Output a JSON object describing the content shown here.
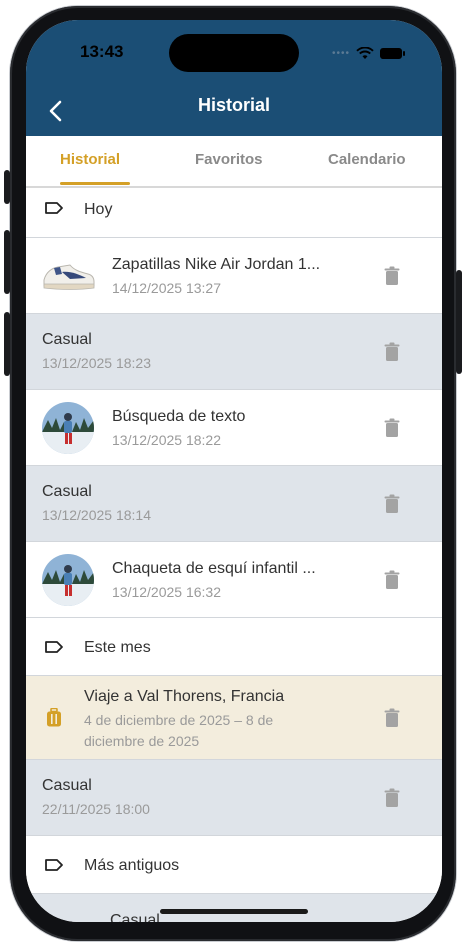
{
  "status_bar": {
    "time": "13:43"
  },
  "header": {
    "title": "Historial"
  },
  "tabs": [
    {
      "label": "Historial",
      "active": true
    },
    {
      "label": "Favoritos",
      "active": false
    },
    {
      "label": "Calendario",
      "active": false
    }
  ],
  "sections": {
    "today": "Hoy",
    "this_month": "Este mes",
    "older": "Más antiguos"
  },
  "items": [
    {
      "type": "product",
      "icon": "sneaker-thumbnail",
      "title": "Zapatillas Nike Air Jordan 1...",
      "date": "14/12/2025 13:27"
    },
    {
      "type": "outfit",
      "title": "Casual",
      "date": "13/12/2025 18:23"
    },
    {
      "type": "search",
      "icon": "ski-photo-thumbnail",
      "title": "Búsqueda de texto",
      "date": "13/12/2025 18:22"
    },
    {
      "type": "outfit",
      "title": "Casual",
      "date": "13/12/2025 18:14"
    },
    {
      "type": "product",
      "icon": "ski-photo-thumbnail",
      "title": "Chaqueta de esquí infantil ...",
      "date": "13/12/2025 16:32"
    },
    {
      "type": "trip",
      "icon": "suitcase-icon",
      "title": "Viaje a Val Thorens, Francia",
      "date_line1": "4 de diciembre de 2025 – 8 de",
      "date_line2": "diciembre de 2025"
    },
    {
      "type": "outfit",
      "title": "Casual",
      "date": "22/11/2025 18:00"
    },
    {
      "type": "outfit",
      "title": "Casual"
    }
  ],
  "colors": {
    "header_bg": "#1b4e75",
    "accent": "#d4a027",
    "outfit_row_bg": "#dfe4ea",
    "trip_row_bg": "#f3eddd"
  }
}
